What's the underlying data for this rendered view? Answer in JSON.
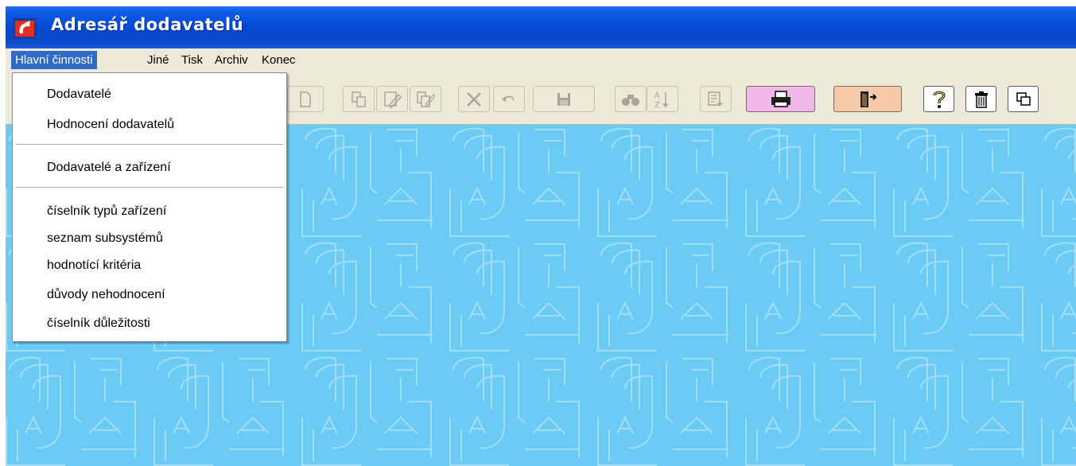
{
  "window": {
    "title": "Adresář dodavatelů"
  },
  "menubar": {
    "items": [
      {
        "label": "Hlavní činnosti",
        "active": true
      },
      {
        "label": "Jiné"
      },
      {
        "label": "Tisk"
      },
      {
        "label": "Archiv"
      },
      {
        "label": "Konec"
      }
    ]
  },
  "dropdown": {
    "groups": [
      [
        "Dodavatelé",
        "Hodnocení dodavatelů"
      ],
      [
        "Dodavatelé a zařízení"
      ],
      [
        "číselník typů zařízení",
        "seznam subsystémů",
        "hodnotící kritéria",
        "důvody nehodnocení",
        "číselník důležitosti"
      ]
    ]
  },
  "toolbar": {
    "icons": [
      "new-icon",
      "copy-icon",
      "edit-icon",
      "edit-copy-icon",
      "delete-icon",
      "undo-icon",
      "save-icon",
      "find-icon",
      "sort-icon",
      "filter-icon",
      "print-icon",
      "exit-icon",
      "help-icon",
      "trash-icon",
      "windows-icon"
    ]
  },
  "colors": {
    "titlebar": "#0a4ccd",
    "menu_highlight": "#316ac5",
    "desktop": "#6ccbf5",
    "print_button": "#f0b8e8",
    "exit_button": "#f5c8a8"
  }
}
